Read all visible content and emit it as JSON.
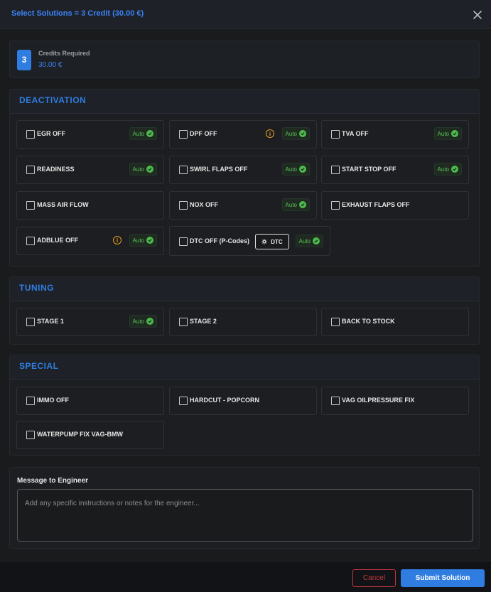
{
  "header": {
    "title": "Select Solutions = 3 Credit (30.00 €)"
  },
  "credits": {
    "count": "3",
    "label": "Credits Required",
    "value": "30.00 €"
  },
  "sections": {
    "deactivation": {
      "title": "DEACTIVATION",
      "options": [
        {
          "label": "EGR OFF",
          "auto": "Auto"
        },
        {
          "label": "DPF OFF",
          "auto": "Auto",
          "info": "i"
        },
        {
          "label": "TVA OFF",
          "auto": "Auto"
        },
        {
          "label": "READINESS",
          "auto": "Auto"
        },
        {
          "label": "SWIRL FLAPS OFF",
          "auto": "Auto"
        },
        {
          "label": "START STOP OFF",
          "auto": "Auto"
        },
        {
          "label": "MASS AIR FLOW"
        },
        {
          "label": "NOX OFF",
          "auto": "Auto"
        },
        {
          "label": "EXHAUST FLAPS OFF"
        },
        {
          "label": "ADBLUE OFF",
          "auto": "Auto",
          "info": "i"
        },
        {
          "label": "DTC OFF (P-Codes)",
          "auto": "Auto",
          "button": "DTC"
        }
      ]
    },
    "tuning": {
      "title": "TUNING",
      "options": [
        {
          "label": "STAGE 1",
          "auto": "Auto"
        },
        {
          "label": "STAGE 2"
        },
        {
          "label": "BACK TO STOCK"
        }
      ]
    },
    "special": {
      "title": "SPECIAL",
      "options": [
        {
          "label": "IMMO OFF"
        },
        {
          "label": "HARDCUT - POPCORN"
        },
        {
          "label": "VAG OILPRESSURE FIX"
        },
        {
          "label": "WATERPUMP FIX VAG-BMW"
        }
      ]
    }
  },
  "message": {
    "label": "Message to Engineer",
    "placeholder": "Add any specific instructions or notes for the engineer...",
    "value": ""
  },
  "footer": {
    "cancel_label": "Cancel",
    "submit_label": "Submit Solution"
  },
  "colors": {
    "accent": "#2f7de1",
    "auto_green": "#4cbb4c",
    "warning": "#e8a020",
    "danger": "#c0373f"
  }
}
